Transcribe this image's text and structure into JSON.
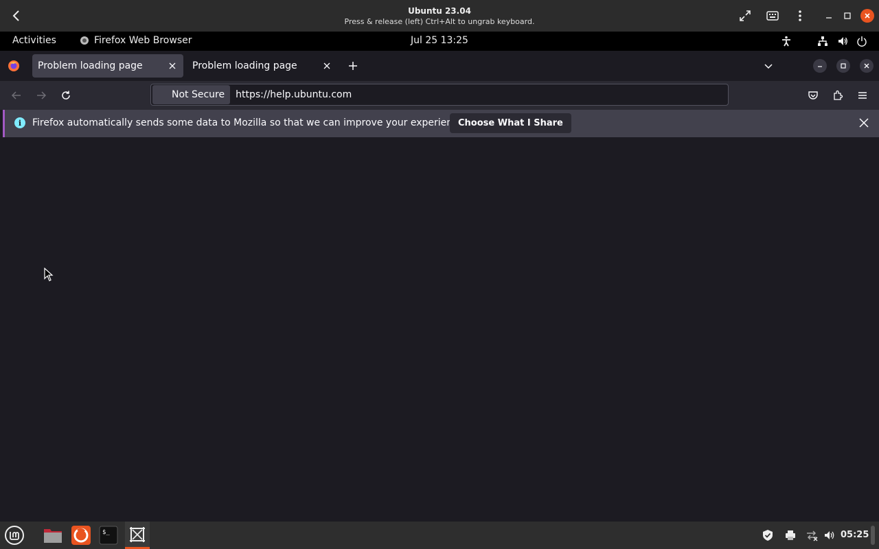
{
  "vm": {
    "title": "Ubuntu 23.04",
    "subtitle": "Press & release (left) Ctrl+Alt to ungrab keyboard."
  },
  "gnome": {
    "activities": "Activities",
    "app_name": "Firefox Web Browser",
    "clock": "Jul 25  13:25"
  },
  "tabs": [
    {
      "title": "Problem loading page",
      "active": true
    },
    {
      "title": "Problem loading page",
      "active": false
    }
  ],
  "urlbar": {
    "security_label": "Not Secure",
    "url": "https://help.ubuntu.com"
  },
  "notification": {
    "message": "Firefox automatically sends some data to Mozilla so that we can improve your experience.",
    "button_label": "Choose What I Share"
  },
  "taskbar": {
    "clock": "05:25",
    "items": [
      "mint-menu-icon",
      "files-icon",
      "firefox-icon",
      "terminal-icon",
      "screenshot-tool-icon"
    ]
  },
  "colors": {
    "accent": "#e95420",
    "notification_bar": "#42414d",
    "page_background": "#1c1b22"
  }
}
